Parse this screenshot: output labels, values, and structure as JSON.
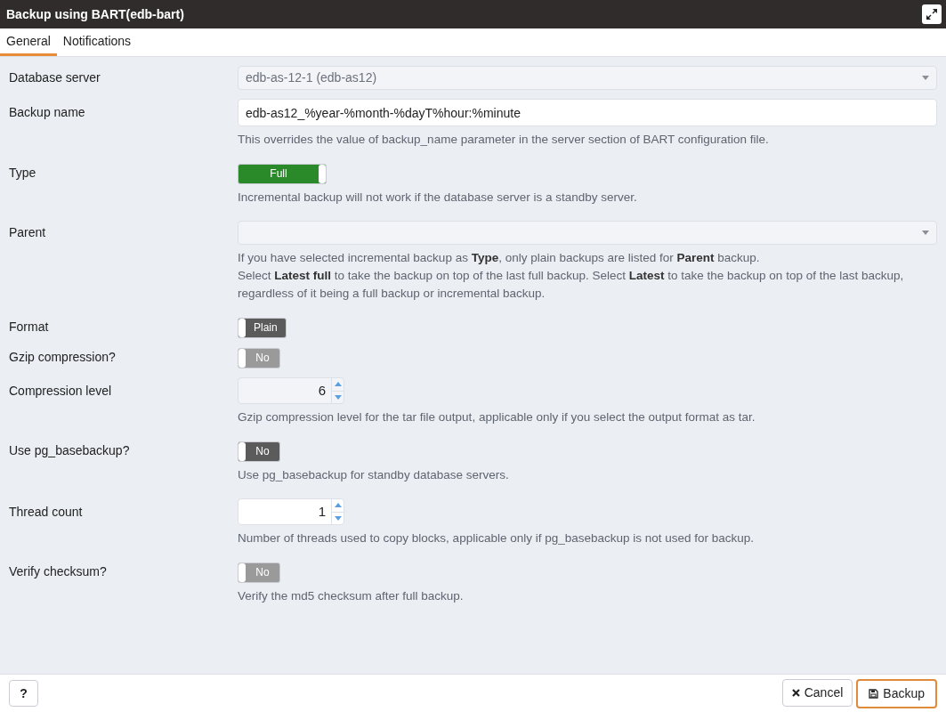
{
  "window": {
    "title": "Backup using BART(edb-bart)"
  },
  "tabs": [
    {
      "label": "General",
      "selected": true
    },
    {
      "label": "Notifications",
      "selected": false
    }
  ],
  "fields": [
    {
      "label": "Database server",
      "kind": "select",
      "value": "edb-as-12-1 (edb-as12)",
      "disabled": true
    },
    {
      "label": "Backup name",
      "kind": "text",
      "value": "edb-as12_%year-%month-%dayT%hour:%minute",
      "help": [
        "This overrides the value of backup_name parameter in the server section of BART configuration file."
      ]
    },
    {
      "label": "Type",
      "kind": "toggle",
      "value": "Full",
      "on": true,
      "disabled": false,
      "help": [
        "Incremental backup will not work if the database server is a standby server."
      ]
    },
    {
      "label": "Parent",
      "kind": "select",
      "disabled": true,
      "help": [
        "If you have selected incremental backup as **Type**, only plain backups are listed for **Parent** backup.",
        "Select **Latest full** to take the backup on top of the last full backup. Select **Latest** to take the backup on top of the last backup, regardless of it being a full backup or incremental backup."
      ]
    },
    {
      "label": "Format",
      "kind": "toggle",
      "value": "Plain",
      "on": false,
      "disabled": false
    },
    {
      "label": "Gzip compression?",
      "kind": "toggle",
      "value": "No",
      "on": false,
      "disabled": true
    },
    {
      "label": "Compression level",
      "kind": "number",
      "value": "6",
      "disabled": true,
      "help": [
        "Gzip compression level for the tar file output, applicable only if you select the output format as tar."
      ]
    },
    {
      "label": "Use pg_basebackup?",
      "kind": "toggle",
      "value": "No",
      "on": false,
      "disabled": false,
      "help": [
        "Use pg_basebackup for standby database servers."
      ]
    },
    {
      "label": "Thread count",
      "kind": "number",
      "value": "1",
      "disabled": false,
      "help": [
        "Number of threads used to copy blocks, applicable only if pg_basebackup is not used for backup."
      ]
    },
    {
      "label": "Verify checksum?",
      "kind": "toggle",
      "value": "No",
      "on": false,
      "disabled": true,
      "help": [
        "Verify the md5 checksum after full backup."
      ]
    }
  ],
  "footer": {
    "help_button": "?",
    "buttons": [
      {
        "label": "Cancel",
        "kind": "cancel"
      },
      {
        "label": "Backup",
        "kind": "primary"
      }
    ]
  }
}
